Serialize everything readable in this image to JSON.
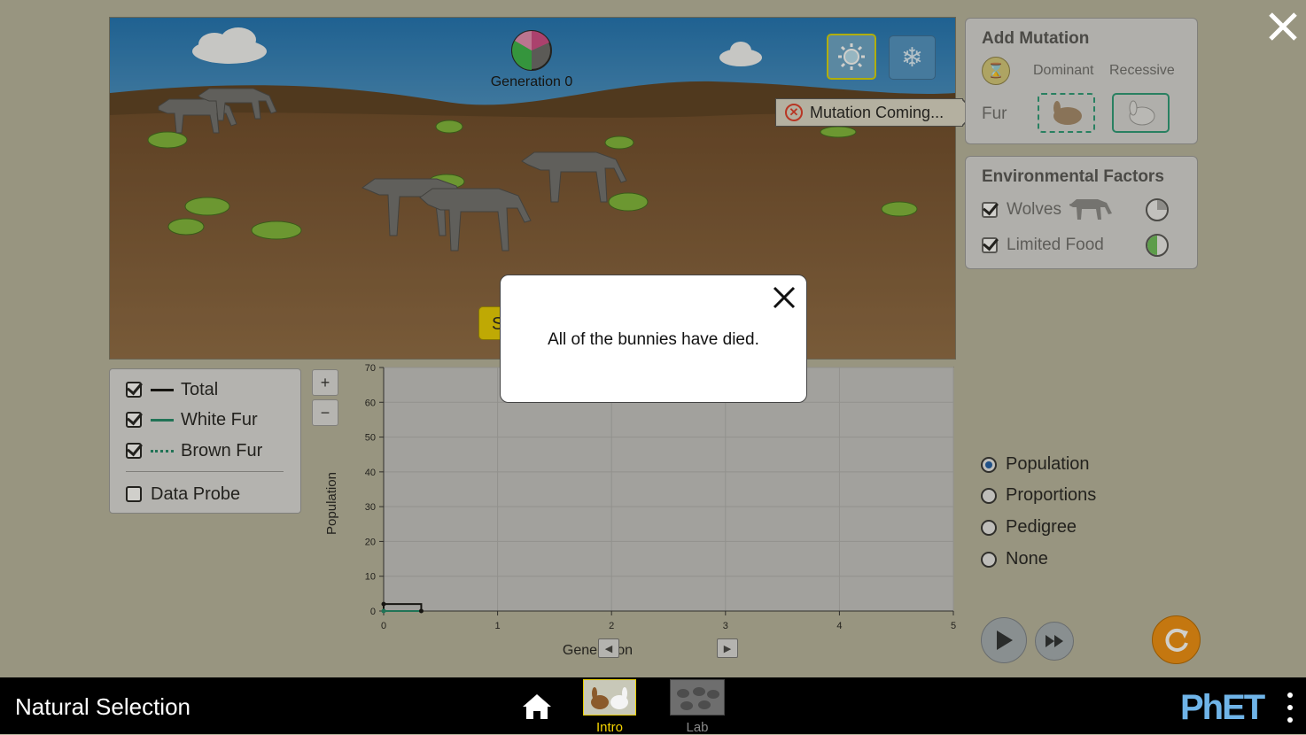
{
  "app": {
    "title": "Natural Selection"
  },
  "scene": {
    "generation_label": "Generation 0",
    "mutation_coming_label": "Mutation Coming...",
    "start_button_partial": "S"
  },
  "mutation_panel": {
    "title": "Add Mutation",
    "col_dominant": "Dominant",
    "col_recessive": "Recessive",
    "row_fur": "Fur"
  },
  "env_panel": {
    "title": "Environmental Factors",
    "wolves_label": "Wolves",
    "wolves_checked": true,
    "food_label": "Limited Food",
    "food_checked": true
  },
  "legend": {
    "items": [
      {
        "label": "Total",
        "checked": true,
        "color": "#111111",
        "style": "solid"
      },
      {
        "label": "White Fur",
        "checked": true,
        "color": "#1f8a6a",
        "style": "solid"
      },
      {
        "label": "Brown Fur",
        "checked": true,
        "color": "#1f8a6a",
        "style": "dotted"
      }
    ],
    "data_probe_label": "Data Probe",
    "data_probe_checked": false
  },
  "zoom": {
    "in_label": "+",
    "out_label": "−"
  },
  "chart_data": {
    "type": "line",
    "xlabel": "Generation",
    "ylabel": "Population",
    "xlim": [
      0,
      5
    ],
    "ylim": [
      0,
      70
    ],
    "xticks": [
      "0",
      "1",
      "2",
      "3",
      "4",
      "5"
    ],
    "yticks": [
      "0",
      "10",
      "20",
      "30",
      "40",
      "50",
      "60",
      "70"
    ],
    "grid": true,
    "series": [
      {
        "name": "Total",
        "x": [
          0,
          0,
          0.33,
          0.33
        ],
        "y": [
          0,
          2,
          2,
          0
        ],
        "color": "#111111",
        "style": "solid"
      },
      {
        "name": "White Fur",
        "x": [
          0,
          0.33
        ],
        "y": [
          0,
          0
        ],
        "color": "#1f8a6a",
        "style": "solid"
      },
      {
        "name": "Brown Fur",
        "x": [
          0,
          0.33
        ],
        "y": [
          0,
          0
        ],
        "color": "#1f8a6a",
        "style": "dotted"
      }
    ]
  },
  "graph_type": {
    "options": [
      "Population",
      "Proportions",
      "Pedigree",
      "None"
    ],
    "selected": "Population"
  },
  "modal": {
    "message": "All of the bunnies have died."
  },
  "nav": {
    "tabs": [
      {
        "label": "Intro",
        "active": true
      },
      {
        "label": "Lab",
        "active": false
      }
    ],
    "brand": "PhET"
  },
  "colors": {
    "accent_yellow": "#f5d400",
    "reset_orange": "#f08f10",
    "brand_blue": "#6fb4e8"
  }
}
